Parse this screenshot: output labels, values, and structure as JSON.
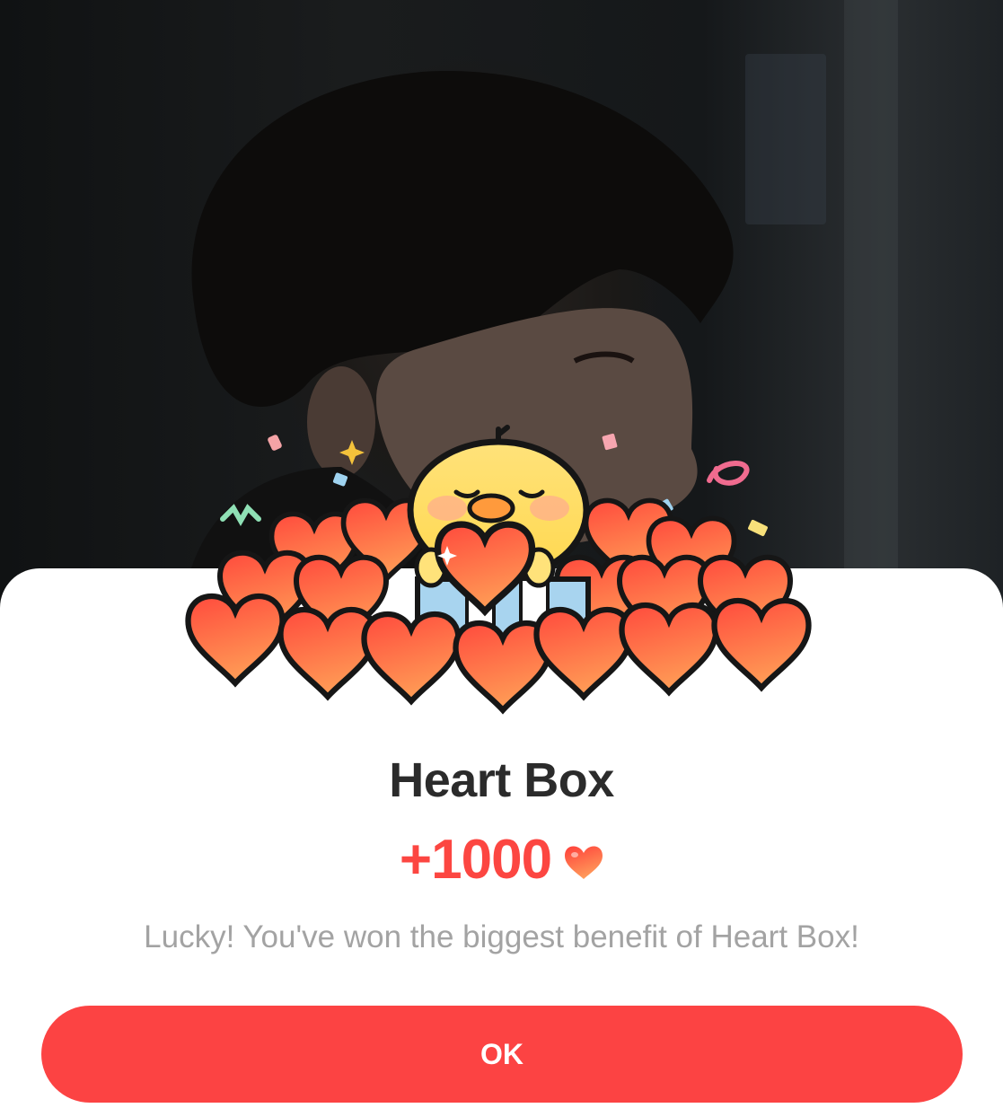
{
  "dialog": {
    "title": "Heart Box",
    "amount": "+1000",
    "message": "Lucky! You've won the biggest benefit of Heart Box!",
    "ok_label": "OK",
    "reward_icon": "heart-icon"
  },
  "colors": {
    "accent": "#fc4641",
    "button": "#fc4343",
    "title": "#2b2b2b",
    "message": "#a3a3a3",
    "sheet": "#ffffff"
  }
}
